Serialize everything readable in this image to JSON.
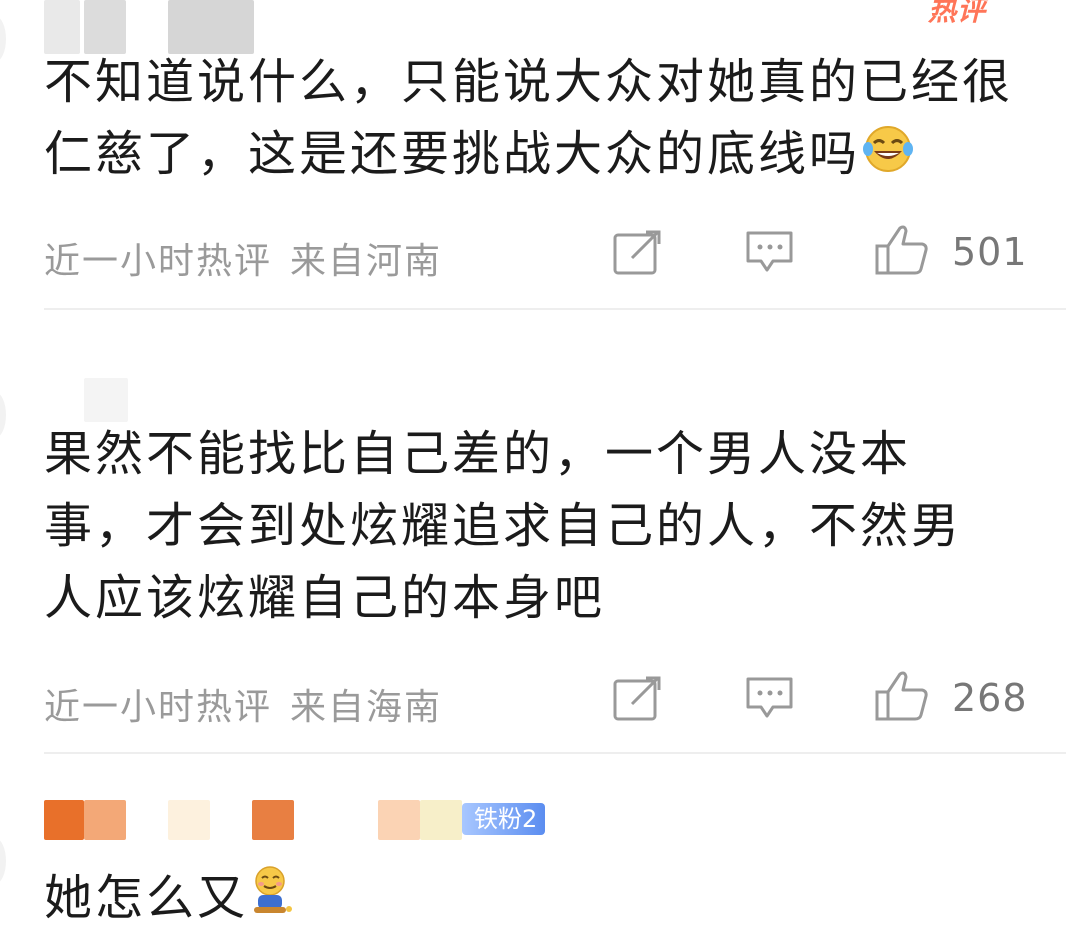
{
  "hot_badge": "热评",
  "comments": [
    {
      "text": "不知道说什么，只能说大众对她真的已经很仁慈了，这是还要挑战大众的底线吗",
      "time": "近一小时热评",
      "location": "来自河南",
      "likes": "501",
      "emoji": "laughing-tears"
    },
    {
      "text": "果然不能找比自己差的，一个男人没本事，才会到处炫耀追求自己的人，不然男人应该炫耀自己的本身吧",
      "time": "近一小时热评",
      "location": "来自海南",
      "likes": "268"
    },
    {
      "text": "她怎么又",
      "fan_badge": "铁粉2",
      "emoji": "shy-sitting"
    }
  ],
  "colors": {
    "hot": "#ff5d3b",
    "meta": "#9a9a9a",
    "badge": "#5b8df0"
  }
}
